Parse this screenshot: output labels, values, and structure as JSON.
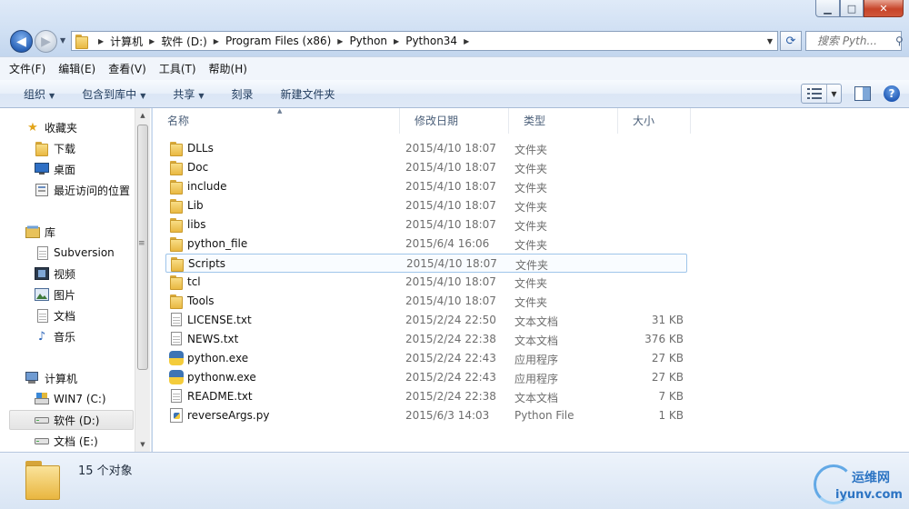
{
  "window": {
    "min_label": "▁",
    "max_label": "□",
    "close_label": "✕"
  },
  "address": {
    "crumbs": [
      "计算机",
      "软件 (D:)",
      "Program Files (x86)",
      "Python",
      "Python34"
    ]
  },
  "search": {
    "placeholder": "搜索 Pyth..."
  },
  "menu": [
    "文件(F)",
    "编辑(E)",
    "查看(V)",
    "工具(T)",
    "帮助(H)"
  ],
  "toolbar": {
    "organize": "组织",
    "include_library": "包含到库中",
    "share": "共享",
    "burn": "刻录",
    "new_folder": "新建文件夹"
  },
  "nav": {
    "favorites": "收藏夹",
    "downloads": "下载",
    "desktop": "桌面",
    "recent": "最近访问的位置",
    "libraries": "库",
    "subversion": "Subversion",
    "videos": "视频",
    "pictures": "图片",
    "documents": "文档",
    "music": "音乐",
    "computer": "计算机",
    "drive_c": "WIN7 (C:)",
    "drive_d": "软件 (D:)",
    "drive_e": "文档 (E:)"
  },
  "columns": {
    "name": "名称",
    "modified": "修改日期",
    "type": "类型",
    "size": "大小"
  },
  "files": [
    {
      "name": "DLLs",
      "date": "2015/4/10 18:07",
      "type": "文件夹",
      "size": "",
      "icon": "folder"
    },
    {
      "name": "Doc",
      "date": "2015/4/10 18:07",
      "type": "文件夹",
      "size": "",
      "icon": "folder"
    },
    {
      "name": "include",
      "date": "2015/4/10 18:07",
      "type": "文件夹",
      "size": "",
      "icon": "folder"
    },
    {
      "name": "Lib",
      "date": "2015/4/10 18:07",
      "type": "文件夹",
      "size": "",
      "icon": "folder"
    },
    {
      "name": "libs",
      "date": "2015/4/10 18:07",
      "type": "文件夹",
      "size": "",
      "icon": "folder"
    },
    {
      "name": "python_file",
      "date": "2015/6/4 16:06",
      "type": "文件夹",
      "size": "",
      "icon": "folder"
    },
    {
      "name": "Scripts",
      "date": "2015/4/10 18:07",
      "type": "文件夹",
      "size": "",
      "icon": "folder"
    },
    {
      "name": "tcl",
      "date": "2015/4/10 18:07",
      "type": "文件夹",
      "size": "",
      "icon": "folder"
    },
    {
      "name": "Tools",
      "date": "2015/4/10 18:07",
      "type": "文件夹",
      "size": "",
      "icon": "folder"
    },
    {
      "name": "LICENSE.txt",
      "date": "2015/2/24 22:50",
      "type": "文本文档",
      "size": "31 KB",
      "icon": "text"
    },
    {
      "name": "NEWS.txt",
      "date": "2015/2/24 22:38",
      "type": "文本文档",
      "size": "376 KB",
      "icon": "text"
    },
    {
      "name": "python.exe",
      "date": "2015/2/24 22:43",
      "type": "应用程序",
      "size": "27 KB",
      "icon": "python-exe"
    },
    {
      "name": "pythonw.exe",
      "date": "2015/2/24 22:43",
      "type": "应用程序",
      "size": "27 KB",
      "icon": "python-exe"
    },
    {
      "name": "README.txt",
      "date": "2015/2/24 22:38",
      "type": "文本文档",
      "size": "7 KB",
      "icon": "text"
    },
    {
      "name": "reverseArgs.py",
      "date": "2015/6/3 14:03",
      "type": "Python File",
      "size": "1 KB",
      "icon": "python-file"
    }
  ],
  "hovered_row": "Scripts",
  "status": {
    "item_count": "15 个对象"
  },
  "watermark": {
    "line1": "运维网",
    "line2": "iyunv.com"
  },
  "colors": {
    "accent": "#2a63b8",
    "hover_border": "#9fc5ea",
    "frame": "#c9dcf2"
  }
}
